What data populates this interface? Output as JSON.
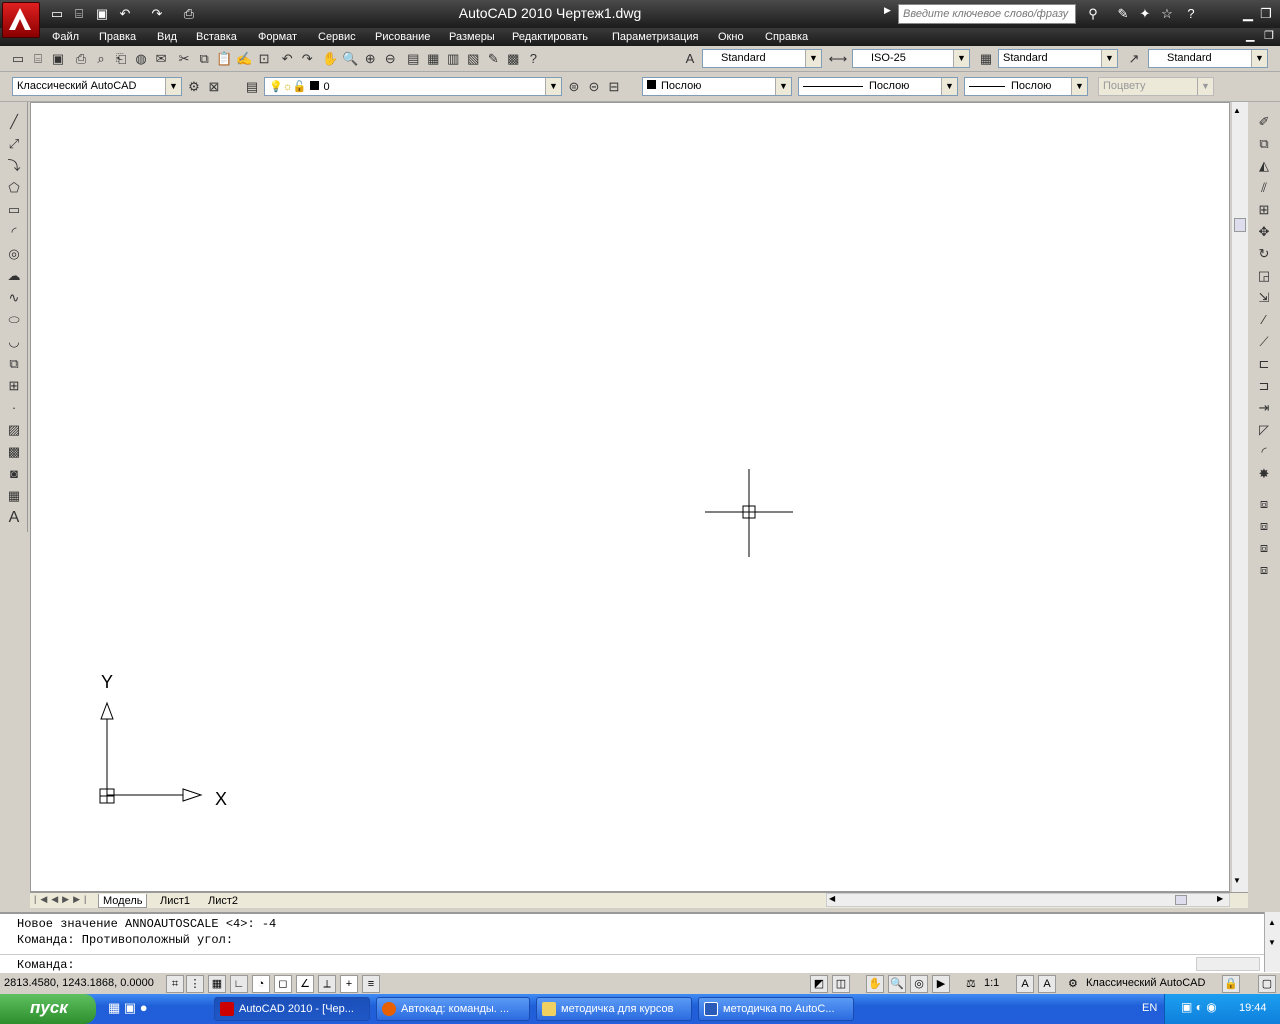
{
  "window": {
    "title": "AutoCAD 2010    Чертеж1.dwg",
    "search_placeholder": "Введите ключевое слово/фразу"
  },
  "menu": [
    "Файл",
    "Правка",
    "Вид",
    "Вставка",
    "Формат",
    "Сервис",
    "Рисование",
    "Размеры",
    "Редактировать",
    "Параметризация",
    "Окно",
    "Справка"
  ],
  "styles": {
    "text_style": "Standard",
    "dim_style": "ISO-25",
    "table_style": "Standard",
    "mleader_style": "Standard"
  },
  "workspace": {
    "name": "Классический AutoCAD"
  },
  "layer": {
    "name": "0"
  },
  "properties": {
    "color": "Послою",
    "linetype": "Послою",
    "lineweight": "Послою",
    "plotstyle": "Поцвету"
  },
  "ucs": {
    "x_label": "X",
    "y_label": "Y"
  },
  "tabs": [
    "Модель",
    "Лист1",
    "Лист2"
  ],
  "command": {
    "line1": "Новое значение ANNOAUTOSCALE <4>: -4",
    "line2": "Команда: Противоположный угол:",
    "prompt": "Команда:"
  },
  "status": {
    "coords": "2813.4580, 1243.1868, 0.0000",
    "scale": "1:1",
    "workspace": "Классический AutoCAD"
  },
  "taskbar": {
    "start": "пуск",
    "tasks": [
      "AutoCAD 2010 - [Чер...",
      "Автокад: команды. ...",
      "методичка для курсов",
      "методичка по AutoC..."
    ],
    "lang": "EN",
    "time": "19:44"
  }
}
